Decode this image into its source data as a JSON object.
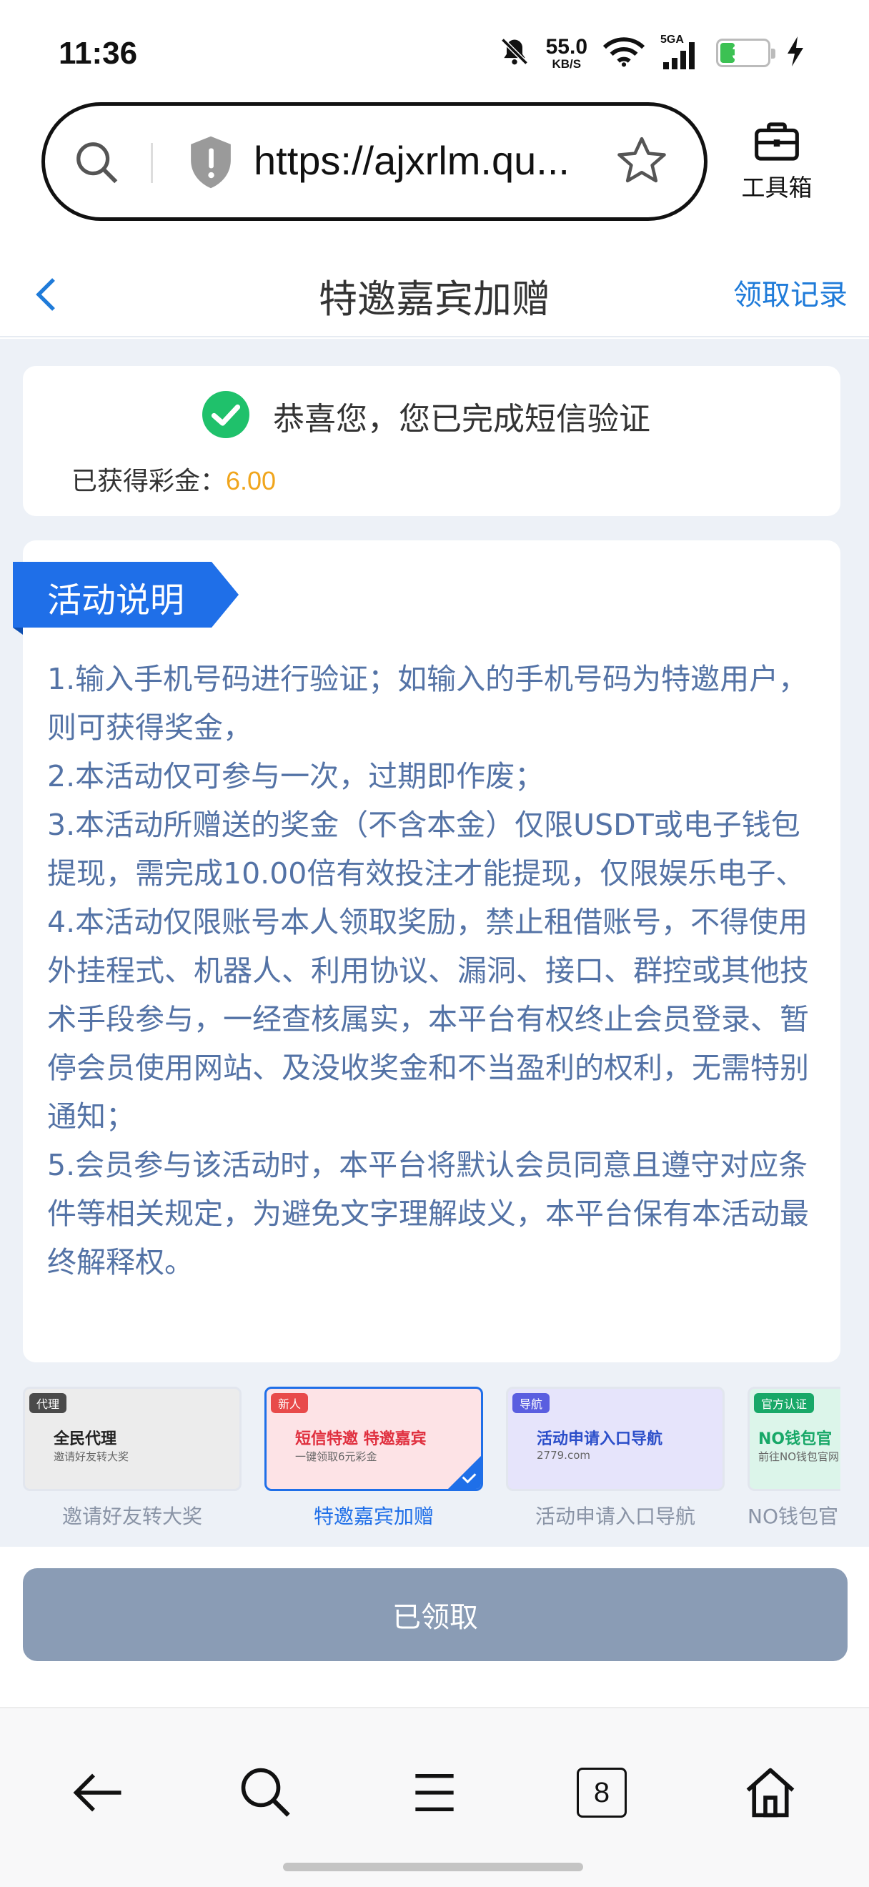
{
  "status_bar": {
    "time": "11:36",
    "net_speed_value": "55.0",
    "net_speed_unit": "KB/S",
    "signal_label": "5GA",
    "battery": "31",
    "battery_level": 0.31
  },
  "browser": {
    "url": "https://ajxrlm.qu...",
    "toolbox_label": "工具箱"
  },
  "header": {
    "title": "特邀嘉宾加赠",
    "records_link": "领取记录"
  },
  "status_card": {
    "success_text": "恭喜您，您已完成短信验证",
    "bonus_label": "已获得彩金：",
    "bonus_value": "6.00"
  },
  "rules": {
    "section_title": "活动说明",
    "items": [
      "1.输入手机号码进行验证；如输入的手机号码为特邀用户，则可获得奖金，",
      "2.本活动仅可参与一次，过期即作废；",
      "3.本活动所赠送的奖金（不含本金）仅限USDT或电子钱包提现，需完成10.00倍有效投注才能提现，仅限娱乐电子、",
      "4.本活动仅限账号本人领取奖励，禁止租借账号，不得使用外挂程式、机器人、利用协议、漏洞、接口、群控或其他技术手段参与，一经查核属实，本平台有权终止会员登录、暂停会员使用网站、及没收奖金和不当盈利的权利，无需特别通知；",
      "5.会员参与该活动时，本平台将默认会员同意且遵守对应条件等相关规定，为避免文字理解歧义，本平台保有本活动最终解释权。"
    ]
  },
  "promos": [
    {
      "badge": "代理",
      "title": "全民代理",
      "subtitle": "邀请好友转大奖",
      "label": "邀请好友转大奖",
      "badge_color": "#4a4a4a",
      "bg": "#ececec",
      "title_color": "#222222",
      "active": false
    },
    {
      "badge": "新人",
      "title": "短信特邀 特邀嘉宾",
      "subtitle": "一键领取6元彩金",
      "label": "特邀嘉宾加赠",
      "badge_color": "#e84a4a",
      "bg": "#fde3e6",
      "title_color": "#e0303f",
      "active": true
    },
    {
      "badge": "导航",
      "title": "活动申请入口导航",
      "subtitle": "2779.com",
      "label": "活动申请入口导航",
      "badge_color": "#5a5ee0",
      "bg": "#e6e4fb",
      "title_color": "#2b4ec9",
      "active": false
    },
    {
      "badge": "官方认证",
      "title": "NO钱包官",
      "subtitle": "前往NO钱包官网",
      "label": "NO钱包官",
      "badge_color": "#18a868",
      "bg": "#dcf5ea",
      "title_color": "#18a868",
      "active": false
    }
  ],
  "claim": {
    "button_label": "已领取"
  },
  "nav": {
    "tab_count": "8"
  }
}
